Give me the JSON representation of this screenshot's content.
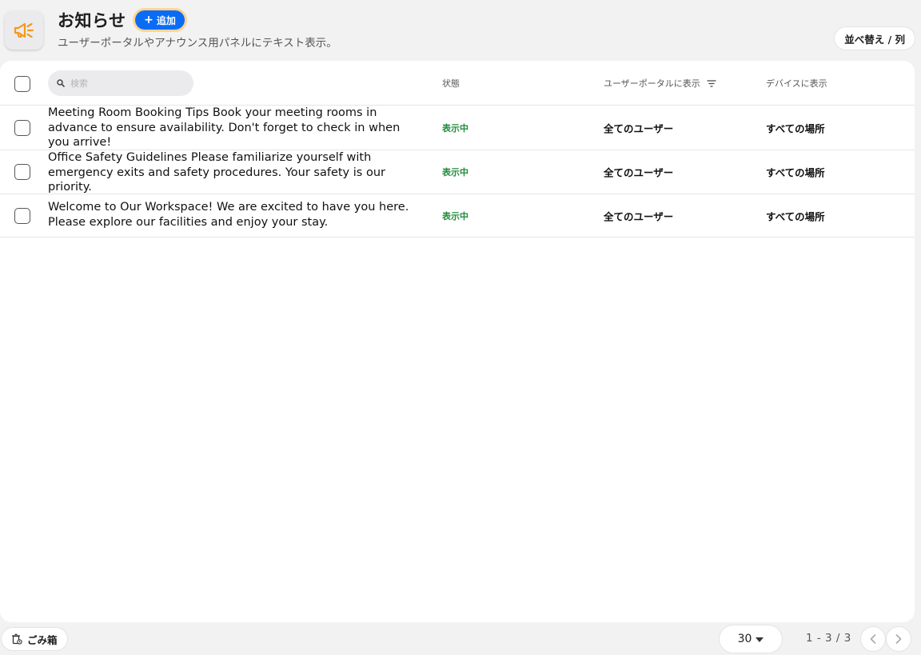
{
  "header": {
    "icon": "megaphone-icon",
    "accent": "#f29a1b",
    "title": "お知らせ",
    "add_label": "追加",
    "subtitle": "ユーザーポータルやアナウンス用パネルにテキスト表示。",
    "sort_label": "並べ替え / 列"
  },
  "table": {
    "search_placeholder": "検索",
    "columns": {
      "status": "状態",
      "portal": "ユーザーポータルに表示",
      "device": "デバイスに表示"
    },
    "status_color": "#1e8b3a",
    "rows": [
      {
        "title": "Meeting Room Booking Tips Book your meeting rooms in advance to ensure availability. Don't forget to check in when you arrive!",
        "status": "表示中",
        "portal": "全てのユーザー",
        "device": "すべての場所"
      },
      {
        "title": "Office Safety Guidelines Please familiarize yourself with emergency exits and safety procedures. Your safety is our priority.",
        "status": "表示中",
        "portal": "全てのユーザー",
        "device": "すべての場所"
      },
      {
        "title": "Welcome to Our Workspace! We are excited to have you here. Please explore our facilities and enjoy your stay.",
        "status": "表示中",
        "portal": "全てのユーザー",
        "device": "すべての場所"
      }
    ]
  },
  "footer": {
    "trash_label": "ごみ箱",
    "page_size": "30",
    "range": "1 - 3 / 3"
  }
}
